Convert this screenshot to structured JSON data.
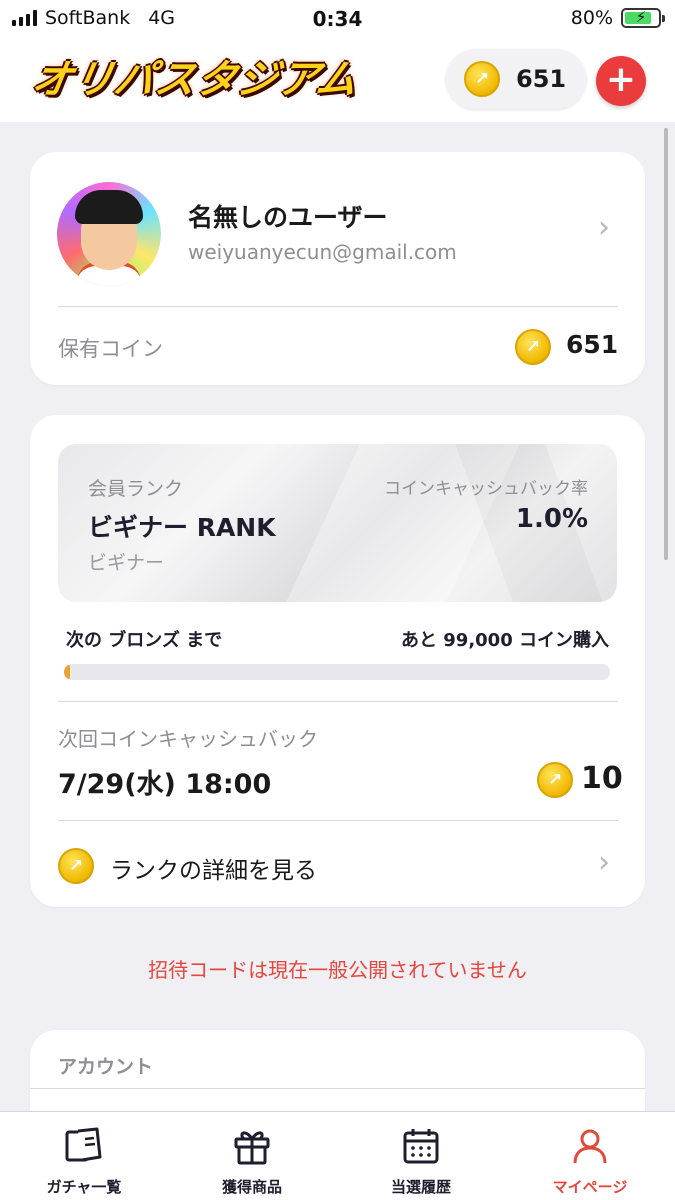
{
  "status_bar": {
    "carrier": "SoftBank",
    "network": "4G",
    "time": "0:34",
    "battery_percent": "80%",
    "battery_level": 0.8
  },
  "header": {
    "logo_text": "オリパスタジアム",
    "coin_balance": "651",
    "add_button": "+"
  },
  "profile": {
    "name": "名無しのユーザー",
    "email": "weiyuanyecun@gmail.com",
    "coins_label": "保有コイン",
    "coins_value": "651"
  },
  "rank": {
    "label": "会員ランク",
    "name": "ビギナー RANK",
    "sub_name": "ビギナー",
    "cashback_label": "コインキャッシュバック率",
    "cashback_rate": "1.0%",
    "next_rank_text": "次の ブロンズ まで",
    "remaining_text": "あと 99,000 コイン購入",
    "progress_fraction": 0.01,
    "next_cashback_label": "次回コインキャッシュバック",
    "next_cashback_date": "7/29(水) 18:00",
    "next_cashback_amount": "10",
    "detail_link": "ランクの詳細を見る"
  },
  "invite_notice": "招待コードは現在一般公開されていません",
  "account": {
    "title": "アカウント"
  },
  "tab_bar": {
    "items": [
      {
        "label": "ガチャ一覧",
        "icon": "cards-icon"
      },
      {
        "label": "獲得商品",
        "icon": "gift-icon"
      },
      {
        "label": "当選履歴",
        "icon": "calendar-icon"
      },
      {
        "label": "マイページ",
        "icon": "person-icon",
        "active": true
      }
    ]
  },
  "colors": {
    "accent_red": "#e4483c",
    "coin_gold": "#f0b800",
    "progress_orange": "#f0a030",
    "background": "#efeff4"
  }
}
